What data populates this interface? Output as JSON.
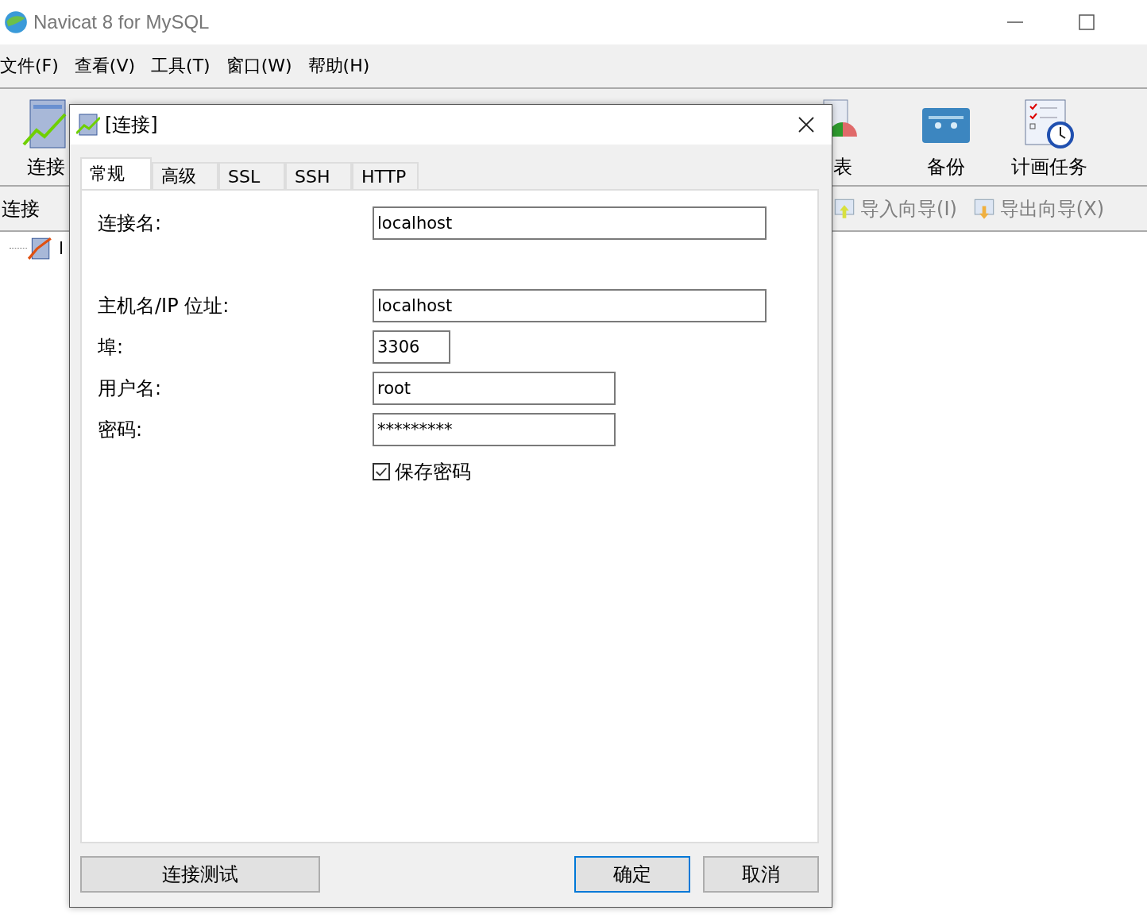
{
  "window": {
    "title": "Navicat 8 for MySQL"
  },
  "menu": [
    "文件(F)",
    "查看(V)",
    "工具(T)",
    "窗口(W)",
    "帮助(H)"
  ],
  "toolbar": [
    {
      "label": "连接",
      "kind": "connect"
    },
    {
      "label": "表",
      "kind": "chart"
    },
    {
      "label": "备份",
      "kind": "backup"
    },
    {
      "label": "计画任务",
      "kind": "schedule"
    }
  ],
  "left_panel": {
    "title": "连接",
    "tree": [
      {
        "label": "l"
      }
    ]
  },
  "wizards": [
    {
      "label": "导入向导(I)",
      "kind": "import",
      "disabled": true
    },
    {
      "label": "导出向导(X)",
      "kind": "export",
      "disabled": true
    }
  ],
  "dialog": {
    "title": "[连接]",
    "tabs": [
      {
        "label": "常规",
        "selected": true
      },
      {
        "label": "高级",
        "selected": false
      },
      {
        "label": "SSL",
        "selected": false
      },
      {
        "label": "SSH",
        "selected": false
      },
      {
        "label": "HTTP",
        "selected": false
      }
    ],
    "fields": [
      {
        "label": "连接名:",
        "value": "localhost"
      },
      {
        "label": "主机名/IP 位址:",
        "value": "localhost"
      },
      {
        "label": "埠:",
        "value": "3306"
      },
      {
        "label": "用户名:",
        "value": "root"
      },
      {
        "label": "密码:",
        "value": "*********"
      }
    ],
    "save_password": {
      "label": "保存密码",
      "checked": true
    },
    "buttons": {
      "test": "连接测试",
      "ok": "确定",
      "cancel": "取消"
    }
  }
}
